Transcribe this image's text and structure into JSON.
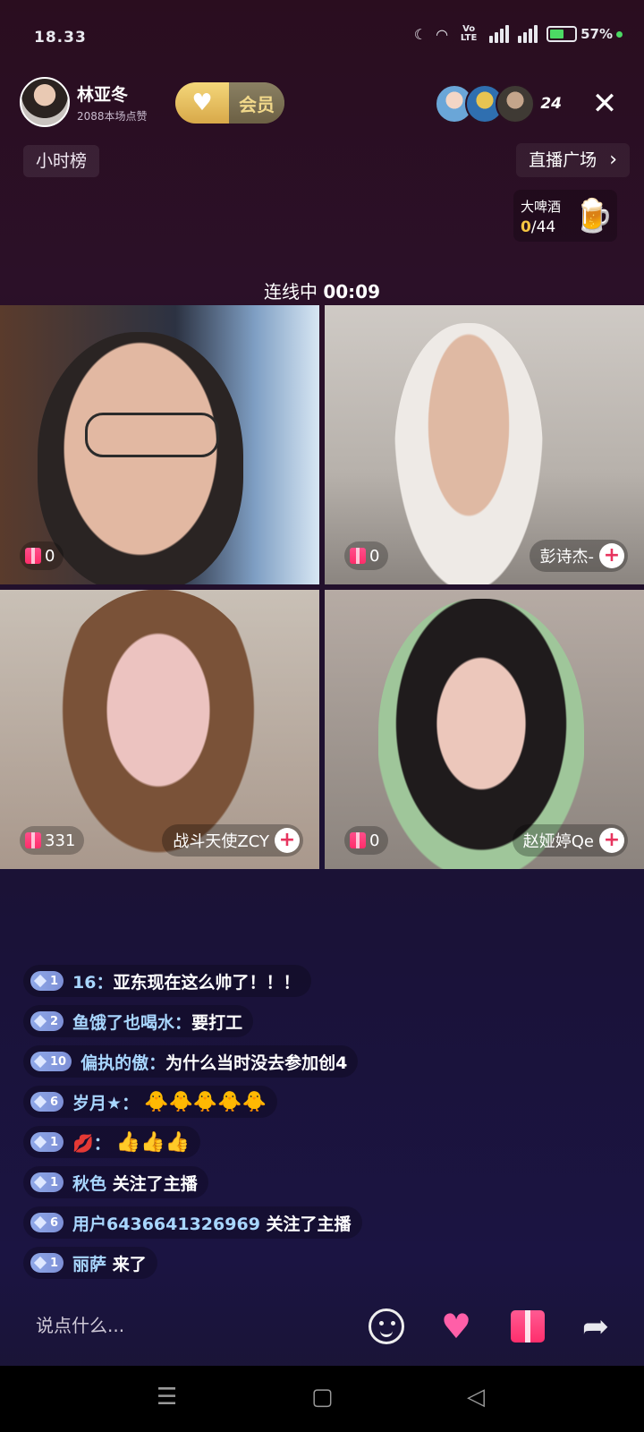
{
  "status": {
    "time": "18.33",
    "battery_pct": "57%",
    "battery_level": 0.57,
    "net": "Vo LTE"
  },
  "host": {
    "name": "林亚冬",
    "likes": "2088本场点赞",
    "vip_label": "会员"
  },
  "viewer_count": "24",
  "hour_rank": "小时榜",
  "plaza": {
    "label": "直播广场"
  },
  "gift_goal": {
    "name": "大啤酒",
    "current": "0",
    "total": "/44"
  },
  "link": {
    "label": "连线中",
    "timer": "00:09"
  },
  "tiles": [
    {
      "gifts": "0",
      "name": ""
    },
    {
      "gifts": "0",
      "name": "彭诗杰-"
    },
    {
      "gifts": "331",
      "name": "战斗天使ZCY"
    },
    {
      "gifts": "0",
      "name": "赵娅婷Qe"
    }
  ],
  "chat": [
    {
      "level": "1",
      "user": "16：",
      "text": "亚东现在这么帅了！！！"
    },
    {
      "level": "2",
      "user": "鱼饿了也喝水：",
      "text": "要打工"
    },
    {
      "level": "10",
      "user": "偏执的傲：",
      "text": "为什么当时没去参加创4"
    },
    {
      "level": "6",
      "user": "岁月★：",
      "text": "",
      "emoji": "🐥🐥🐥🐥🐥"
    },
    {
      "level": "1",
      "user": "💋：",
      "text": "",
      "emoji": "👍👍👍"
    },
    {
      "level": "1",
      "user": "秋色",
      "text": "关注了主播"
    },
    {
      "level": "6",
      "user": "用户6436641326969",
      "text": "关注了主播"
    },
    {
      "level": "1",
      "user": "丽萨",
      "text": "来了"
    }
  ],
  "input": {
    "placeholder": "说点什么..."
  },
  "icons": {
    "moon": "moon-icon",
    "wifi": "wifi-icon",
    "close": "close-icon",
    "chevron": "chevron-right-icon",
    "smile": "smile-icon",
    "heart": "heart-icon",
    "gift": "gift-icon",
    "share": "share-icon"
  },
  "colors": {
    "accent": "#ff2e6c",
    "username": "#a8d6ff",
    "level_badge": "#8fa8e8",
    "gold": "#f5c542"
  }
}
